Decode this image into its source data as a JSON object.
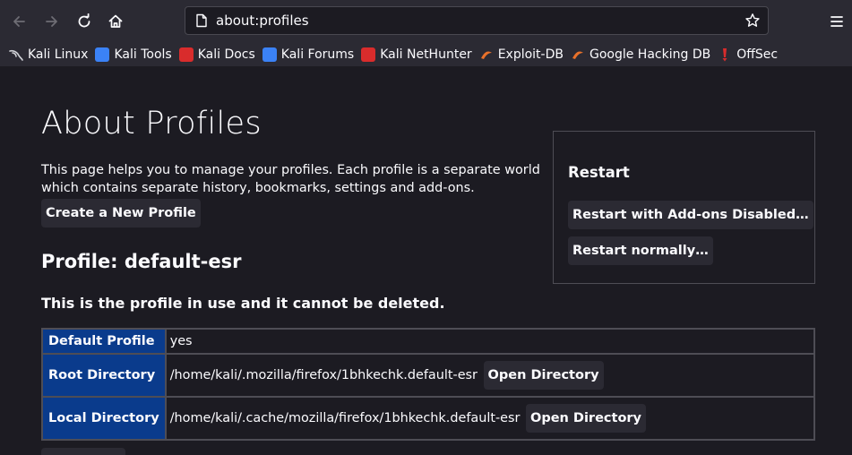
{
  "browser": {
    "url": "about:profiles",
    "bookmarks": [
      {
        "label": "Kali Linux",
        "color": "#cfd1d6"
      },
      {
        "label": "Kali Tools",
        "color": "#3b82f6"
      },
      {
        "label": "Kali Docs",
        "color": "#d92c2c"
      },
      {
        "label": "Kali Forums",
        "color": "#3b82f6"
      },
      {
        "label": "Kali NetHunter",
        "color": "#d92c2c"
      },
      {
        "label": "Exploit-DB",
        "color": "#e8712a"
      },
      {
        "label": "Google Hacking DB",
        "color": "#e8712a"
      },
      {
        "label": "OffSec",
        "color": "#d92c2c"
      }
    ]
  },
  "page": {
    "title": "About Profiles",
    "intro": "This page helps you to manage your profiles. Each profile is a separate world which contains separate history, bookmarks, settings and add-ons.",
    "create_button": "Create a New Profile",
    "profile_heading": "Profile: default-esr",
    "in_use_note": "This is the profile in use and it cannot be deleted.",
    "restart": {
      "title": "Restart",
      "addons_button": "Restart with Add-ons Disabled…",
      "normal_button": "Restart normally…"
    },
    "table": {
      "default_label": "Default Profile",
      "default_value": "yes",
      "root_label": "Root Directory",
      "root_value": "/home/kali/.mozilla/firefox/1bhkechk.default-esr",
      "local_label": "Local Directory",
      "local_value": "/home/kali/.cache/mozilla/firefox/1bhkechk.default-esr",
      "open_button": "Open Directory"
    }
  },
  "colors": {
    "background": "#1c1b22",
    "chrome": "#2b2a33",
    "table_header": "#0a3b8c"
  }
}
